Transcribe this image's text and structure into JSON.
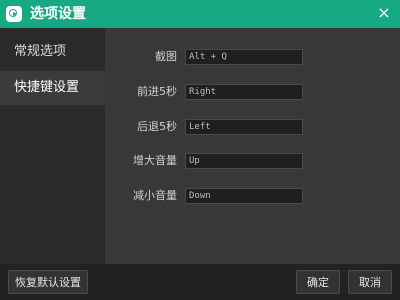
{
  "window": {
    "title": "选项设置",
    "close_label": "×"
  },
  "sidebar": {
    "items": [
      {
        "label": "常规选项",
        "active": false
      },
      {
        "label": "快捷键设置",
        "active": true
      }
    ]
  },
  "shortcuts": {
    "rows": [
      {
        "label": "截图",
        "value": "Alt + Q"
      },
      {
        "label": "前进5秒",
        "value": "Right"
      },
      {
        "label": "后退5秒",
        "value": "Left"
      },
      {
        "label": "增大音量",
        "value": "Up"
      },
      {
        "label": "减小音量",
        "value": "Down"
      }
    ]
  },
  "footer": {
    "reset_label": "恢复默认设置",
    "ok_label": "确定",
    "cancel_label": "取消"
  },
  "colors": {
    "titlebar": "#17a884",
    "sidebar_bg": "#2a2a2a",
    "sidebar_active_bg": "#3b3b3b",
    "content_bg": "#383838",
    "footer_bg": "#222222"
  }
}
